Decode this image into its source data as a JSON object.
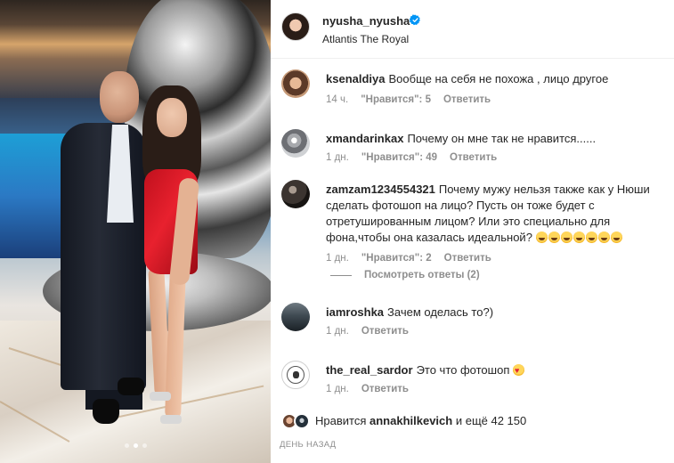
{
  "post": {
    "username": "nyusha_nyusha",
    "location": "Atlantis The Royal",
    "verified_color": "#0095f6"
  },
  "carousel": {
    "count": 3,
    "active": 1
  },
  "labels": {
    "likes_word": "\"Нравится\":",
    "reply": "Ответить"
  },
  "comments": [
    {
      "user": "ksenaldiya",
      "text": "Вообще на себя не похожа , лицо другое",
      "time": "14 ч.",
      "likes": "5",
      "show_likes": true
    },
    {
      "user": "xmandarinkax",
      "text": "Почему он мне так не нравится......",
      "time": "1 дн.",
      "likes": "49",
      "show_likes": true
    },
    {
      "user": "zamzam1234554321",
      "text": "Почему мужу нельзя также как у Нюши сделать фотошоп на лицо? Пусть он тоже будет с отретушированным лицом? Или это специально для фона,чтобы она казалась идеальной?",
      "time": "1 дн.",
      "likes": "2",
      "show_likes": true,
      "view_replies": "Посмотреть ответы (2)",
      "emoji_count": 7
    },
    {
      "user": "iamroshka",
      "text": "Зачем оделась то?)",
      "time": "1 дн.",
      "show_likes": false
    },
    {
      "user": "the_real_sardor",
      "text": "Это что фотошоп",
      "time": "1 дн.",
      "show_likes": false
    }
  ],
  "likes_summary": {
    "prefix": "Нравится",
    "user": "annakhilkevich",
    "suffix": "и ещё 42 150"
  },
  "posted_ago": "ДЕНЬ НАЗАД"
}
